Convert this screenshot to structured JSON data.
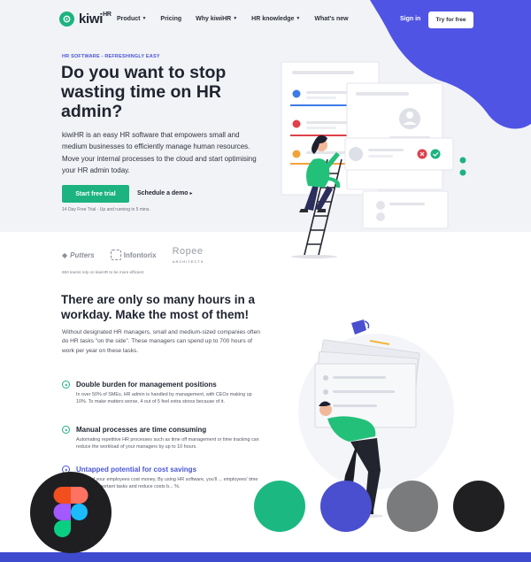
{
  "nav": {
    "brand": "kiwi",
    "brand_sup": "HR",
    "items": [
      {
        "label": "Product",
        "dropdown": true
      },
      {
        "label": "Pricing",
        "dropdown": false
      },
      {
        "label": "Why kiwiHR",
        "dropdown": true
      },
      {
        "label": "HR knowledge",
        "dropdown": true
      },
      {
        "label": "What's new",
        "dropdown": false
      }
    ],
    "signin": "Sign in",
    "try_free": "Try for free"
  },
  "hero": {
    "eyebrow": "HR SOFTWARE - REFRESHINGLY EASY",
    "title": "Do you want to stop wasting time on HR admin?",
    "description": "kiwiHR is an easy HR software that empowers small and medium businesses to efficiently manage human resources. Move your internal processes to the cloud and start optimising your HR admin today.",
    "cta_primary": "Start free trial",
    "cta_secondary": "Schedule a demo",
    "cta_secondary_arrow": "▸",
    "trial_note": "14 Day Free Trial  ·  Up and running in 5 mins."
  },
  "partners": {
    "logos": [
      {
        "name": "Putters",
        "icon": "putters-logo"
      },
      {
        "name": "Infontorix",
        "icon": "infontorix-logo"
      },
      {
        "name": "Ropee",
        "sub": "ARCHITECTS",
        "icon": "ropee-logo"
      }
    ],
    "note": "650 teams rely on kiwiHR to be more efficient"
  },
  "section": {
    "title": "There are only so many hours in a workday. Make the most of them!",
    "description": "Without designated HR managers, small and medium-sized companies often do HR tasks \"on the side\". These managers can spend up to 700 hours of work per year on these tasks."
  },
  "features": [
    {
      "title": "Double burden for management positions",
      "text": "In over 50% of SMEs, HR admin is handled by management, with CEOs making up 10%. To make matters worse, 4 out of 5 feel extra stress because of it."
    },
    {
      "title": "Manual processes are time consuming",
      "text": "Automating repetitive HR processes such as time off management or time tracking can reduce the workload of your managers by up to 10 hours."
    },
    {
      "title": "Untapped potential for cost savings",
      "text": "...ours of your employees cost money. By using HR software, you'll ... employees' time for more important tasks and reduce costs b... %."
    }
  ],
  "colors": {
    "brand_green": "#1db380",
    "brand_blue": "#4a55d8",
    "blob_blue": "#5054e4",
    "swatches": [
      "#1cb882",
      "#4a4fcf",
      "#7a7b7d",
      "#202022"
    ]
  },
  "overlay": {
    "badge_icon": "figma-icon"
  }
}
